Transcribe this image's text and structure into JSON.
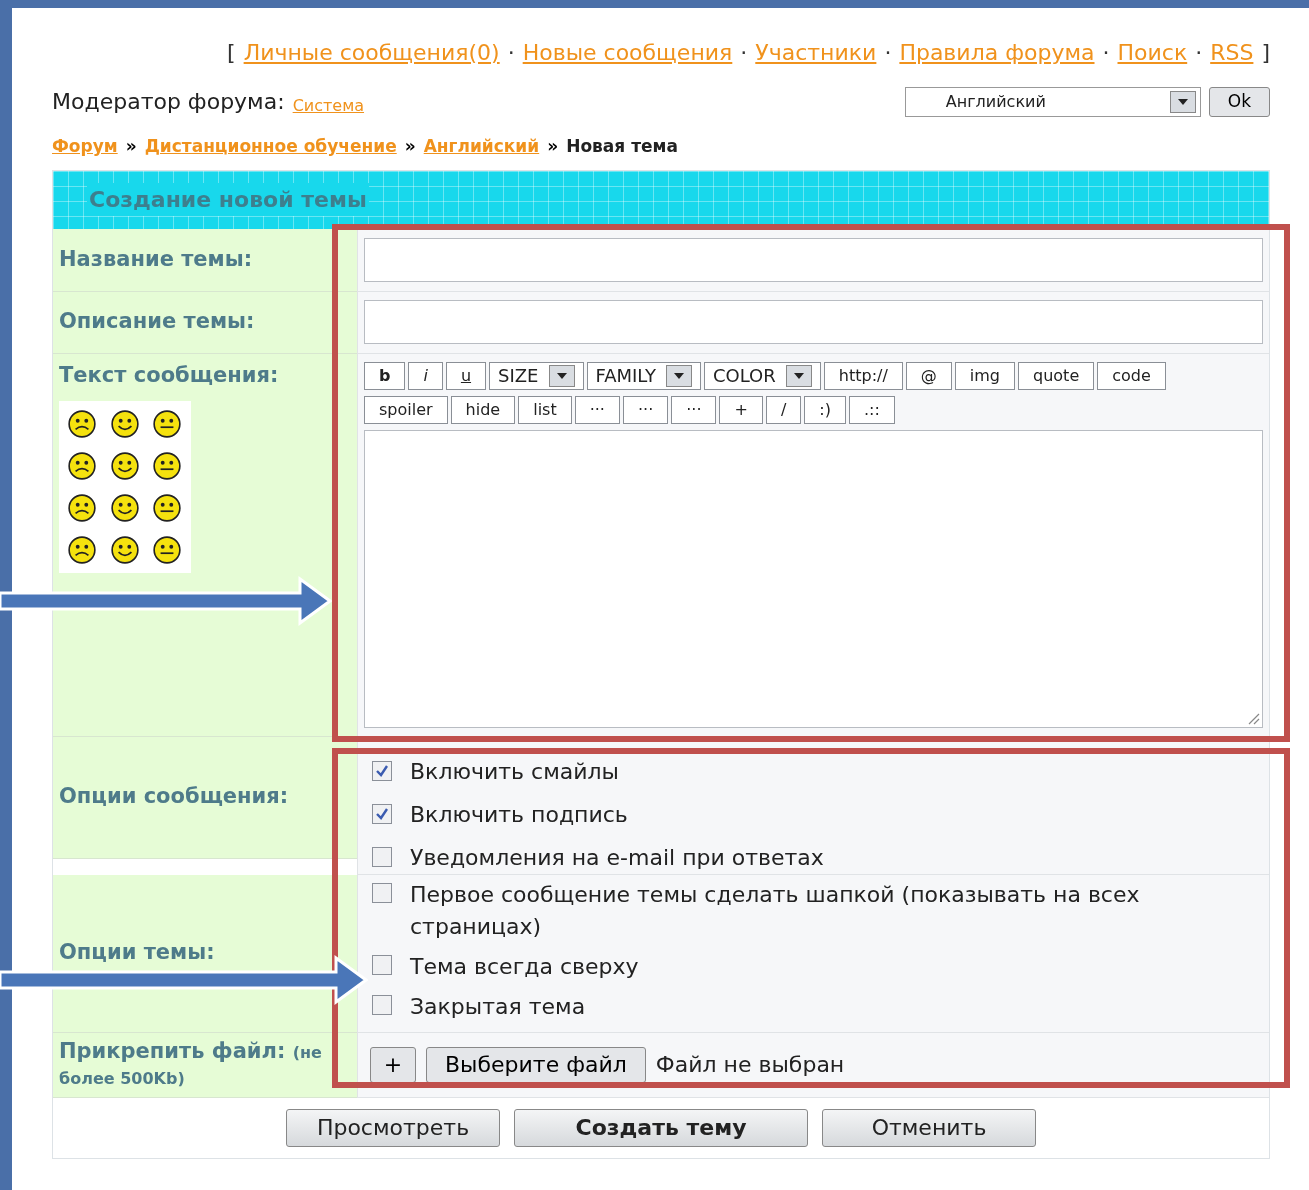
{
  "top_links": [
    "Личные сообщения(0)",
    "Новые сообщения",
    "Участники",
    "Правила форума",
    "Поиск",
    "RSS"
  ],
  "top_brackets": [
    "[",
    "]"
  ],
  "separator": "·",
  "moderator": {
    "label": "Модератор форума:",
    "link": "Система"
  },
  "forum_select": {
    "value": "Английский",
    "button": "Ok"
  },
  "breadcrumb": {
    "links": [
      "Форум",
      "Дистанционное обучение",
      "Английский"
    ],
    "separator": "»",
    "current": "Новая тема"
  },
  "form": {
    "title": "Создание новой темы",
    "title_label": "Название темы:",
    "description_label": "Описание темы:",
    "message_label": "Текст сообщения:",
    "toolbar": [
      {
        "kind": "button",
        "label": "b",
        "selected": false
      },
      {
        "kind": "button",
        "label": "i",
        "selected": false
      },
      {
        "kind": "button",
        "label": "u",
        "selected": false
      },
      {
        "kind": "dropdown",
        "label": "SIZE"
      },
      {
        "kind": "dropdown",
        "label": "FAMILY"
      },
      {
        "kind": "dropdown",
        "label": "COLOR"
      },
      {
        "kind": "button",
        "label": "http://"
      },
      {
        "kind": "button",
        "label": "@"
      },
      {
        "kind": "button",
        "label": "img"
      },
      {
        "kind": "button",
        "label": "quote"
      },
      {
        "kind": "button",
        "label": "code"
      },
      {
        "kind": "break"
      },
      {
        "kind": "button",
        "label": "spoiler"
      },
      {
        "kind": "button",
        "label": "hide"
      },
      {
        "kind": "button",
        "label": "list"
      },
      {
        "kind": "button",
        "label": "···"
      },
      {
        "kind": "button",
        "label": "···"
      },
      {
        "kind": "button",
        "label": "···"
      },
      {
        "kind": "button",
        "label": "+"
      },
      {
        "kind": "button",
        "label": "/"
      },
      {
        "kind": "button",
        "label": ":)"
      },
      {
        "kind": "button",
        "label": ".::"
      }
    ],
    "message_options_label": "Опции сообщения:",
    "message_options": [
      {
        "label": "Включить смайлы",
        "checked": true
      },
      {
        "label": "Включить подпись",
        "checked": true
      },
      {
        "label": "Уведомления на e-mail при ответах",
        "checked": false
      }
    ],
    "topic_options_label": "Опции темы:",
    "topic_options": [
      {
        "label": "Первое сообщение темы сделать шапкой (показывать на всех страницах)",
        "checked": false
      },
      {
        "label": "Тема всегда сверху",
        "checked": false
      },
      {
        "label": "Закрытая тема",
        "checked": false
      }
    ],
    "attach_label": "Прикрепить файл:",
    "attach_hint": "(не более 500Kb)",
    "attach_add": "+",
    "choose_file": "Выберите файл",
    "no_file": "Файл не выбран",
    "buttons": [
      {
        "label": "Просмотреть",
        "kind": "normal"
      },
      {
        "label": "Создать тему",
        "kind": "primary"
      },
      {
        "label": "Отменить",
        "kind": "normal"
      }
    ]
  }
}
